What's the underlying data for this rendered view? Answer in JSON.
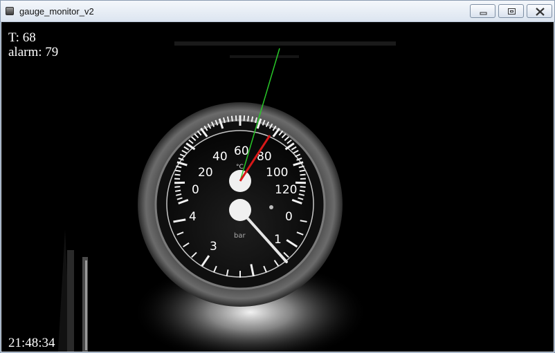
{
  "window": {
    "title": "gauge_monitor_v2",
    "controls": {
      "minimize": "minimize",
      "maximize": "maximize",
      "close": "close"
    }
  },
  "overlay": {
    "temperature": "T: 68",
    "alarm": "alarm: 79",
    "clock": "21:48:34"
  },
  "gauge": {
    "upper_scale_labels": [
      "0",
      "20",
      "40",
      "60",
      "80",
      "100",
      "120"
    ],
    "upper_scale_unit": "°C",
    "lower_scale_labels": [
      "4",
      "3",
      "1",
      "0"
    ],
    "lower_scale_unit": "bar",
    "reading": 68,
    "alarm": 79,
    "reading_line_color": "#28c828",
    "alarm_line_color": "#d81818"
  }
}
